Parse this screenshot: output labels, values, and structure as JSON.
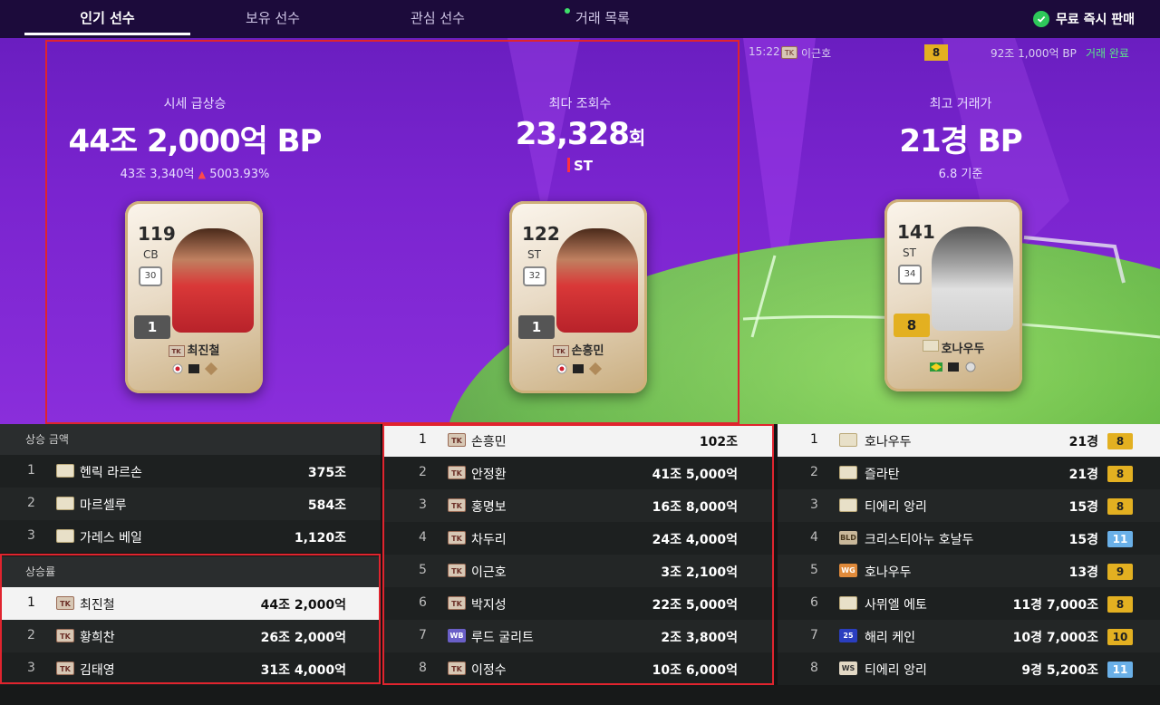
{
  "nav": {
    "tabs": [
      {
        "label": "인기 선수"
      },
      {
        "label": "보유 선수"
      },
      {
        "label": "관심 선수"
      },
      {
        "label": "거래 목록"
      }
    ],
    "instant_sell": "무료 즉시 판매"
  },
  "ticker": {
    "time": "15:22",
    "tag": "TK",
    "name": "이근호",
    "grade": "8",
    "price": "92조 1,000억 BP",
    "status": "거래 완료"
  },
  "hero": {
    "surge": {
      "label": "시세 급상승",
      "value": "44조 2,000억 BP",
      "prev": "43조 3,340억",
      "change": "5003.93%",
      "card": {
        "ovr": "119",
        "pos": "CB",
        "badge": "30",
        "grade": "1",
        "tag": "TK",
        "name": "최진철"
      }
    },
    "views": {
      "label": "최다 조회수",
      "value": "23,328",
      "unit": "회",
      "pos": "ST",
      "card": {
        "ovr": "122",
        "pos": "ST",
        "badge": "32",
        "grade": "1",
        "tag": "TK",
        "name": "손흥민"
      }
    },
    "top_trade": {
      "label": "최고 거래가",
      "value": "21경 BP",
      "sub": "6.8 기준",
      "card": {
        "ovr": "141",
        "pos": "ST",
        "badge": "34",
        "grade": "8",
        "name": "호나우두"
      }
    }
  },
  "left": {
    "rise_amount": {
      "header": "상승 금액",
      "rows": [
        {
          "rank": "1",
          "tag": "",
          "name": "헨릭 라르손",
          "value": "375조"
        },
        {
          "rank": "2",
          "tag": "",
          "name": "마르셀루",
          "value": "584조"
        },
        {
          "rank": "3",
          "tag": "",
          "name": "가레스 베일",
          "value": "1,120조"
        }
      ]
    },
    "rise_rate": {
      "header": "상승률",
      "rows": [
        {
          "rank": "1",
          "tag": "TK",
          "name": "최진철",
          "value": "44조 2,000억"
        },
        {
          "rank": "2",
          "tag": "TK",
          "name": "황희찬",
          "value": "26조 2,000억"
        },
        {
          "rank": "3",
          "tag": "TK",
          "name": "김태영",
          "value": "31조 4,000억"
        }
      ]
    }
  },
  "middle": {
    "rows": [
      {
        "rank": "1",
        "tag": "TK",
        "name": "손흥민",
        "value": "102조"
      },
      {
        "rank": "2",
        "tag": "TK",
        "name": "안정환",
        "value": "41조 5,000억"
      },
      {
        "rank": "3",
        "tag": "TK",
        "name": "홍명보",
        "value": "16조 8,000억"
      },
      {
        "rank": "4",
        "tag": "TK",
        "name": "차두리",
        "value": "24조 4,000억"
      },
      {
        "rank": "5",
        "tag": "TK",
        "name": "이근호",
        "value": "3조 2,100억"
      },
      {
        "rank": "6",
        "tag": "TK",
        "name": "박지성",
        "value": "22조 5,000억"
      },
      {
        "rank": "7",
        "tag": "WB",
        "name": "루드 굴리트",
        "value": "2조 3,800억"
      },
      {
        "rank": "8",
        "tag": "TK",
        "name": "이정수",
        "value": "10조 6,000억"
      }
    ]
  },
  "right": {
    "rows": [
      {
        "rank": "1",
        "tag": "",
        "name": "호나우두",
        "value": "21경",
        "grade": "8",
        "grade_color": "#e3b021"
      },
      {
        "rank": "2",
        "tag": "",
        "name": "즐라탄",
        "value": "21경",
        "grade": "8",
        "grade_color": "#e3b021"
      },
      {
        "rank": "3",
        "tag": "",
        "name": "티에리 앙리",
        "value": "15경",
        "grade": "8",
        "grade_color": "#e3b021"
      },
      {
        "rank": "4",
        "tag": "BLD",
        "name": "크리스티아누 호날두",
        "value": "15경",
        "grade": "11",
        "grade_color": "#6ab0e8"
      },
      {
        "rank": "5",
        "tag": "WG",
        "name": "호나우두",
        "value": "13경",
        "grade": "9",
        "grade_color": "#e3b021"
      },
      {
        "rank": "6",
        "tag": "",
        "name": "사뮈엘 에토",
        "value": "11경 7,000조",
        "grade": "8",
        "grade_color": "#e3b021"
      },
      {
        "rank": "7",
        "tag": "25",
        "name": "해리 케인",
        "value": "10경 7,000조",
        "grade": "10",
        "grade_color": "#e3b021"
      },
      {
        "rank": "8",
        "tag": "WS",
        "name": "티에리 앙리",
        "value": "9경 5,200조",
        "grade": "11",
        "grade_color": "#6ab0e8"
      }
    ]
  }
}
